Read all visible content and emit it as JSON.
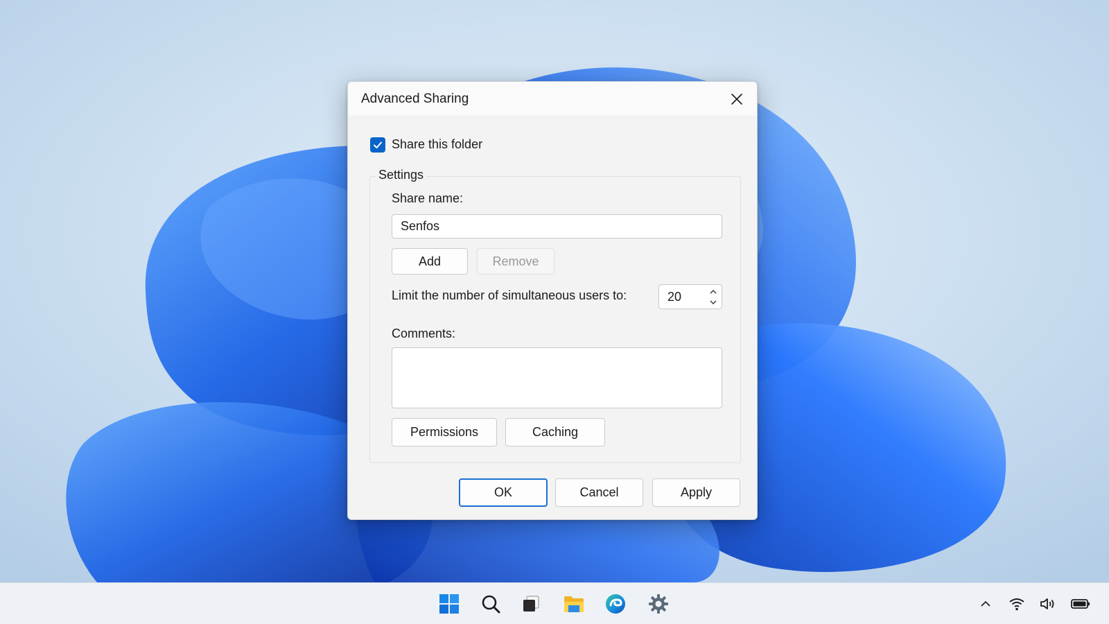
{
  "dialog": {
    "title": "Advanced Sharing",
    "share_checkbox_label": "Share this folder",
    "share_checked": true,
    "settings_legend": "Settings",
    "share_name_label": "Share name:",
    "share_name_value": "Senfos",
    "add_label": "Add",
    "remove_label": "Remove",
    "limit_label": "Limit the number of simultaneous users to:",
    "limit_value": "20",
    "comments_label": "Comments:",
    "comments_value": "",
    "permissions_label": "Permissions",
    "caching_label": "Caching",
    "ok_label": "OK",
    "cancel_label": "Cancel",
    "apply_label": "Apply"
  },
  "taskbar": {
    "icons": [
      "windows-start-icon",
      "search-icon",
      "task-view-icon",
      "file-explorer-icon",
      "edge-browser-icon",
      "settings-gear-icon"
    ],
    "tray": [
      "chevron-up-icon",
      "wifi-icon",
      "volume-icon",
      "battery-icon"
    ]
  },
  "colors": {
    "accent": "#0a63c9",
    "dialog_bg": "#f3f3f3",
    "taskbar_bg": "#eef2f7",
    "wallpaper_bloom": "#1e63e0"
  }
}
